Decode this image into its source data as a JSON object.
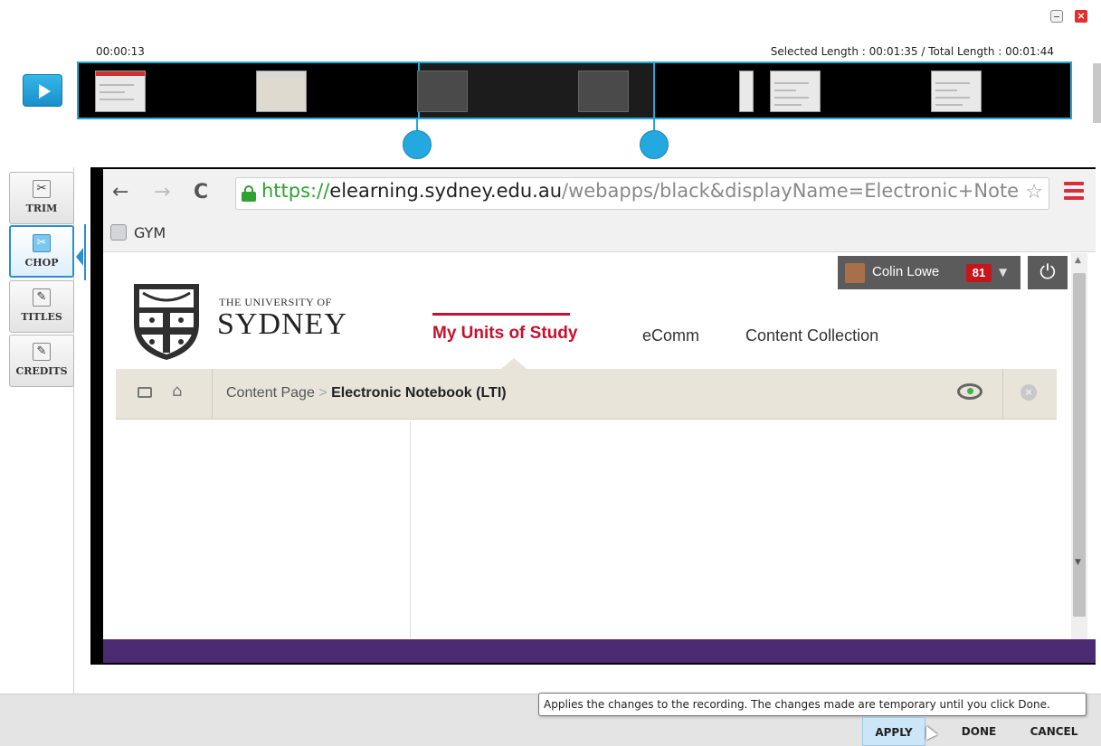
{
  "window": {
    "minimize_icon": "minimize-icon",
    "close_icon": "close-icon"
  },
  "timeline": {
    "current_time": "00:00:13",
    "length_info": "Selected Length : 00:01:35 / Total Length : 00:01:44",
    "play_icon": "play-icon",
    "accent_color": "#22a9da"
  },
  "tools": [
    {
      "label": "TRIM",
      "icon": "trim-scissors-icon",
      "active": false
    },
    {
      "label": "CHOP",
      "icon": "chop-scissors-icon",
      "active": true
    },
    {
      "label": "TITLES",
      "icon": "titles-pen-icon",
      "active": false
    },
    {
      "label": "CREDITS",
      "icon": "credits-pen-icon",
      "active": false
    }
  ],
  "browser": {
    "url_scheme": "https://",
    "url_host": "elearning.sydney.edu.au",
    "url_path": "/webapps/black&displayName=Electronic+Note",
    "bookmark_label": "GYM"
  },
  "site": {
    "user_name": "Colin Lowe",
    "notification_count": "81",
    "uni_small": "THE UNIVERSITY OF",
    "uni_big": "SYDNEY",
    "nav_active": "My Units of Study",
    "nav_link_1": "eComm",
    "nav_link_2": "Content Collection",
    "breadcrumb_parent": "Content Page",
    "breadcrumb_separator": ">",
    "breadcrumb_current": "Electronic Notebook (LTI)",
    "brand_red": "#c8102e",
    "footer_purple": "#4b2a72"
  },
  "bottom": {
    "tooltip": "Applies the changes to the recording. The changes made are temporary until you click Done.",
    "apply_label": "APPLY",
    "done_label": "DONE",
    "cancel_label": "CANCEL"
  }
}
